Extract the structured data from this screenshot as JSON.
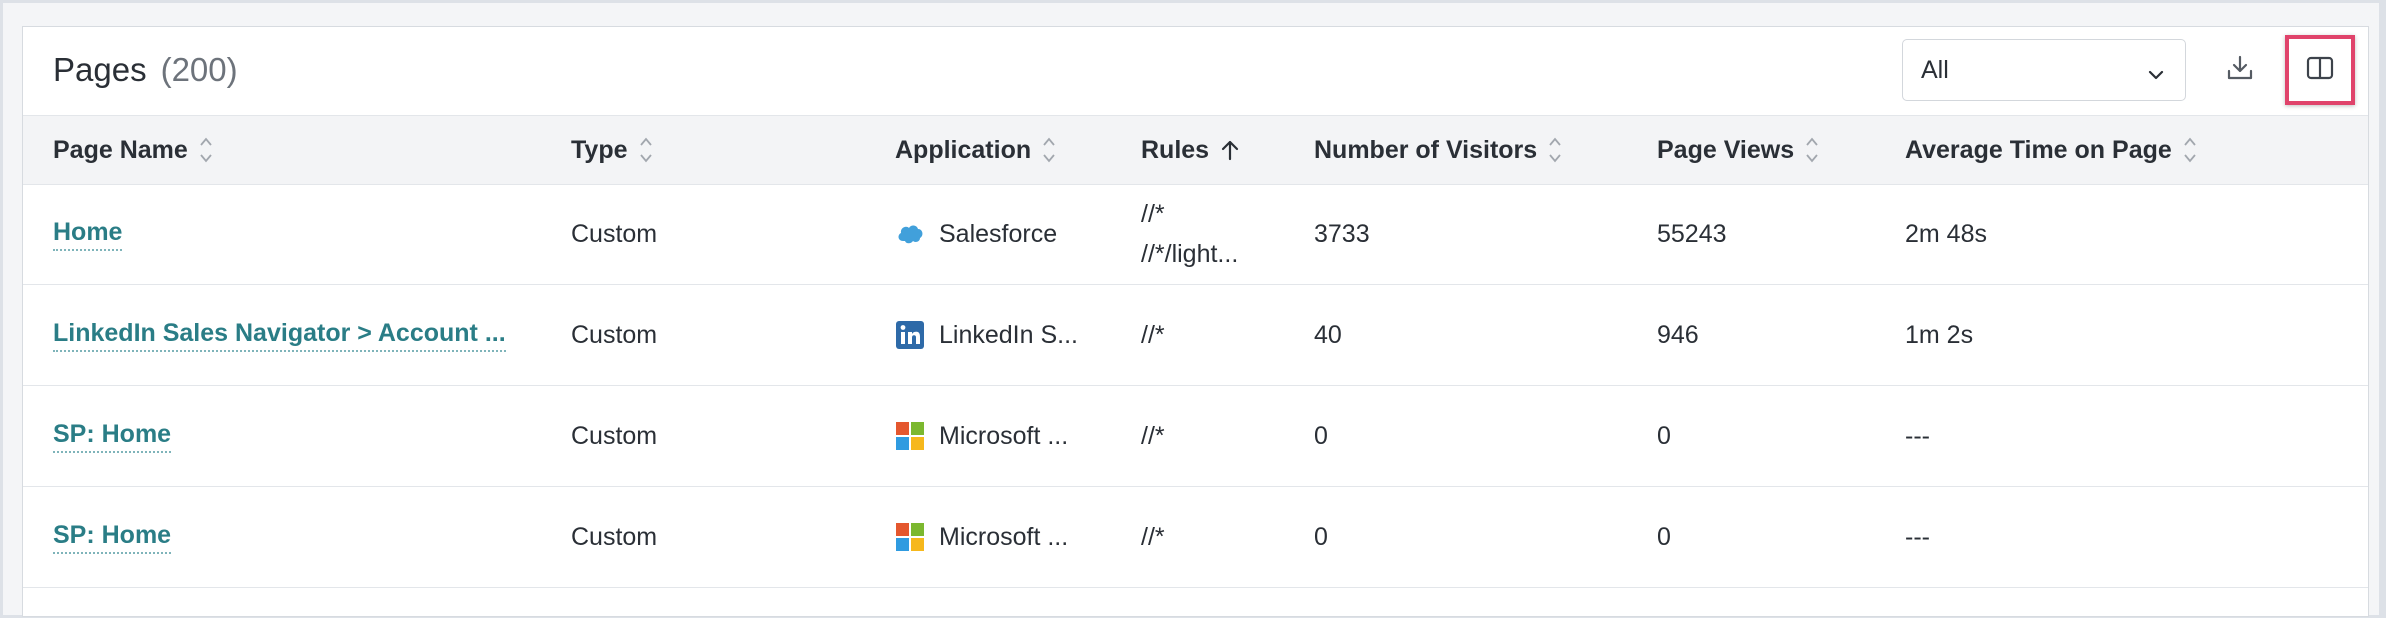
{
  "header": {
    "title": "Pages",
    "count": "(200)"
  },
  "filter": {
    "selected": "All"
  },
  "columns": {
    "page_name": "Page Name",
    "type": "Type",
    "application": "Application",
    "rules": "Rules",
    "visitors": "Number of Visitors",
    "views": "Page Views",
    "avg_time": "Average Time on Page"
  },
  "rows": [
    {
      "name": "Home",
      "type": "Custom",
      "app": "Salesforce",
      "app_icon": "salesforce-icon",
      "rule1": "//*",
      "rule2": "//*/light...",
      "visitors": "3733",
      "views": "55243",
      "avg": "2m 48s"
    },
    {
      "name": "LinkedIn Sales Navigator > Account ...",
      "type": "Custom",
      "app": "LinkedIn S...",
      "app_icon": "linkedin-icon",
      "rule1": "//*",
      "visitors": "40",
      "views": "946",
      "avg": "1m 2s"
    },
    {
      "name": "SP: Home",
      "type": "Custom",
      "app": "Microsoft ...",
      "app_icon": "microsoft-icon",
      "rule1": "//*",
      "visitors": "0",
      "views": "0",
      "avg": "---"
    },
    {
      "name": "SP: Home",
      "type": "Custom",
      "app": "Microsoft ...",
      "app_icon": "microsoft-icon",
      "rule1": "//*",
      "visitors": "0",
      "views": "0",
      "avg": "---"
    }
  ],
  "colors": {
    "link": "#2a7d86",
    "highlight": "#e0436b",
    "salesforce": "#41a0db",
    "linkedin": "#2e6aa8"
  }
}
